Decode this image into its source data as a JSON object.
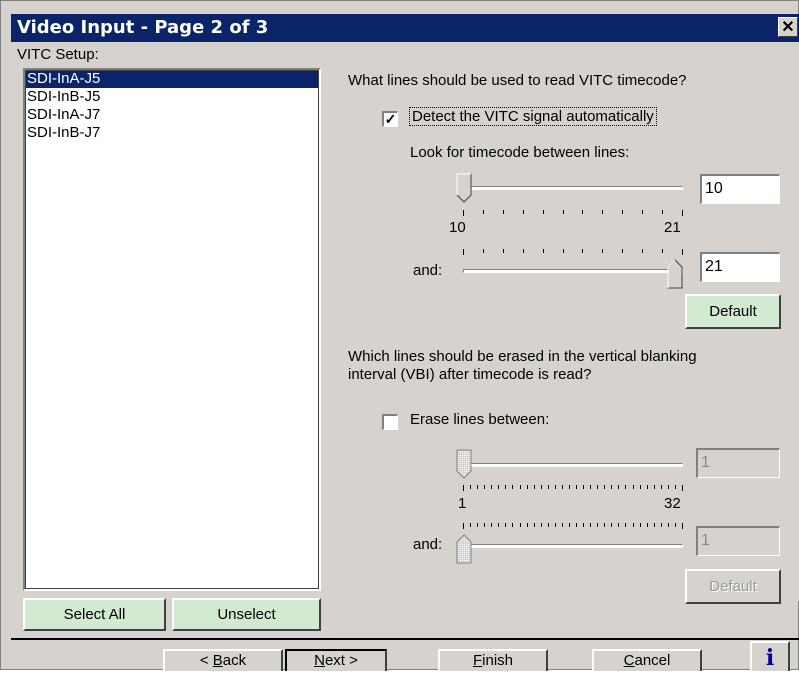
{
  "window": {
    "title": "Video Input - Page 2 of 3"
  },
  "left": {
    "label": "VITC Setup:",
    "items": [
      "SDI-InA-J5",
      "SDI-InB-J5",
      "SDI-InA-J7",
      "SDI-InB-J7"
    ],
    "selected_index": 0,
    "select_all": "Select All",
    "unselect": "Unselect"
  },
  "vitc": {
    "question": "What lines should be used to read VITC timecode?",
    "detect_label": "Detect the VITC signal automatically",
    "detect_checked": true,
    "look_label": "Look for timecode between lines:",
    "slider1_value": "10",
    "min_label": "10",
    "max_label": "21",
    "and_label": "and:",
    "slider2_value": "21",
    "default_label": "Default"
  },
  "erase": {
    "question_line1": "Which lines should be erased in the vertical blanking",
    "question_line2": "interval (VBI) after timecode is read?",
    "erase_label": "Erase lines between:",
    "erase_checked": false,
    "slider1_value": "1",
    "min_label": "1",
    "max_label": "32",
    "and_label": "and:",
    "slider2_value": "1",
    "default_label": "Default"
  },
  "nav": {
    "back_mn": "B",
    "back_rest": "ack",
    "back_prefix": "< ",
    "next_mn": "N",
    "next_rest": "ext >",
    "finish_mn": "F",
    "finish_rest": "inish",
    "cancel_mn": "C",
    "cancel_rest": "ancel",
    "info": "i"
  }
}
